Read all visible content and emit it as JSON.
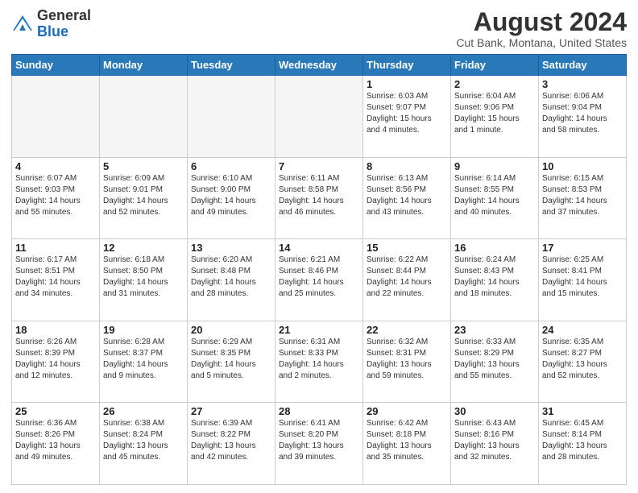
{
  "header": {
    "logo_general": "General",
    "logo_blue": "Blue",
    "month_year": "August 2024",
    "location": "Cut Bank, Montana, United States"
  },
  "days_of_week": [
    "Sunday",
    "Monday",
    "Tuesday",
    "Wednesday",
    "Thursday",
    "Friday",
    "Saturday"
  ],
  "weeks": [
    [
      {
        "day": "",
        "info": ""
      },
      {
        "day": "",
        "info": ""
      },
      {
        "day": "",
        "info": ""
      },
      {
        "day": "",
        "info": ""
      },
      {
        "day": "1",
        "info": "Sunrise: 6:03 AM\nSunset: 9:07 PM\nDaylight: 15 hours\nand 4 minutes."
      },
      {
        "day": "2",
        "info": "Sunrise: 6:04 AM\nSunset: 9:06 PM\nDaylight: 15 hours\nand 1 minute."
      },
      {
        "day": "3",
        "info": "Sunrise: 6:06 AM\nSunset: 9:04 PM\nDaylight: 14 hours\nand 58 minutes."
      }
    ],
    [
      {
        "day": "4",
        "info": "Sunrise: 6:07 AM\nSunset: 9:03 PM\nDaylight: 14 hours\nand 55 minutes."
      },
      {
        "day": "5",
        "info": "Sunrise: 6:09 AM\nSunset: 9:01 PM\nDaylight: 14 hours\nand 52 minutes."
      },
      {
        "day": "6",
        "info": "Sunrise: 6:10 AM\nSunset: 9:00 PM\nDaylight: 14 hours\nand 49 minutes."
      },
      {
        "day": "7",
        "info": "Sunrise: 6:11 AM\nSunset: 8:58 PM\nDaylight: 14 hours\nand 46 minutes."
      },
      {
        "day": "8",
        "info": "Sunrise: 6:13 AM\nSunset: 8:56 PM\nDaylight: 14 hours\nand 43 minutes."
      },
      {
        "day": "9",
        "info": "Sunrise: 6:14 AM\nSunset: 8:55 PM\nDaylight: 14 hours\nand 40 minutes."
      },
      {
        "day": "10",
        "info": "Sunrise: 6:15 AM\nSunset: 8:53 PM\nDaylight: 14 hours\nand 37 minutes."
      }
    ],
    [
      {
        "day": "11",
        "info": "Sunrise: 6:17 AM\nSunset: 8:51 PM\nDaylight: 14 hours\nand 34 minutes."
      },
      {
        "day": "12",
        "info": "Sunrise: 6:18 AM\nSunset: 8:50 PM\nDaylight: 14 hours\nand 31 minutes."
      },
      {
        "day": "13",
        "info": "Sunrise: 6:20 AM\nSunset: 8:48 PM\nDaylight: 14 hours\nand 28 minutes."
      },
      {
        "day": "14",
        "info": "Sunrise: 6:21 AM\nSunset: 8:46 PM\nDaylight: 14 hours\nand 25 minutes."
      },
      {
        "day": "15",
        "info": "Sunrise: 6:22 AM\nSunset: 8:44 PM\nDaylight: 14 hours\nand 22 minutes."
      },
      {
        "day": "16",
        "info": "Sunrise: 6:24 AM\nSunset: 8:43 PM\nDaylight: 14 hours\nand 18 minutes."
      },
      {
        "day": "17",
        "info": "Sunrise: 6:25 AM\nSunset: 8:41 PM\nDaylight: 14 hours\nand 15 minutes."
      }
    ],
    [
      {
        "day": "18",
        "info": "Sunrise: 6:26 AM\nSunset: 8:39 PM\nDaylight: 14 hours\nand 12 minutes."
      },
      {
        "day": "19",
        "info": "Sunrise: 6:28 AM\nSunset: 8:37 PM\nDaylight: 14 hours\nand 9 minutes."
      },
      {
        "day": "20",
        "info": "Sunrise: 6:29 AM\nSunset: 8:35 PM\nDaylight: 14 hours\nand 5 minutes."
      },
      {
        "day": "21",
        "info": "Sunrise: 6:31 AM\nSunset: 8:33 PM\nDaylight: 14 hours\nand 2 minutes."
      },
      {
        "day": "22",
        "info": "Sunrise: 6:32 AM\nSunset: 8:31 PM\nDaylight: 13 hours\nand 59 minutes."
      },
      {
        "day": "23",
        "info": "Sunrise: 6:33 AM\nSunset: 8:29 PM\nDaylight: 13 hours\nand 55 minutes."
      },
      {
        "day": "24",
        "info": "Sunrise: 6:35 AM\nSunset: 8:27 PM\nDaylight: 13 hours\nand 52 minutes."
      }
    ],
    [
      {
        "day": "25",
        "info": "Sunrise: 6:36 AM\nSunset: 8:26 PM\nDaylight: 13 hours\nand 49 minutes."
      },
      {
        "day": "26",
        "info": "Sunrise: 6:38 AM\nSunset: 8:24 PM\nDaylight: 13 hours\nand 45 minutes."
      },
      {
        "day": "27",
        "info": "Sunrise: 6:39 AM\nSunset: 8:22 PM\nDaylight: 13 hours\nand 42 minutes."
      },
      {
        "day": "28",
        "info": "Sunrise: 6:41 AM\nSunset: 8:20 PM\nDaylight: 13 hours\nand 39 minutes."
      },
      {
        "day": "29",
        "info": "Sunrise: 6:42 AM\nSunset: 8:18 PM\nDaylight: 13 hours\nand 35 minutes."
      },
      {
        "day": "30",
        "info": "Sunrise: 6:43 AM\nSunset: 8:16 PM\nDaylight: 13 hours\nand 32 minutes."
      },
      {
        "day": "31",
        "info": "Sunrise: 6:45 AM\nSunset: 8:14 PM\nDaylight: 13 hours\nand 28 minutes."
      }
    ]
  ]
}
